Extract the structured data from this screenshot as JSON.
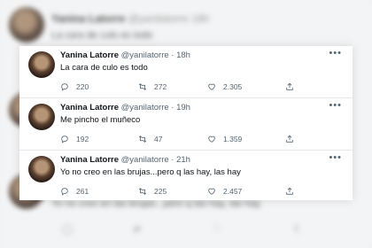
{
  "background": {
    "name": "Yanina Latorre",
    "handle": "@yanilatorre",
    "time": "18h",
    "text": "La cara de culo es todo",
    "bottom_text": "Yo no creo en las brujas...pero q las hay, las hay"
  },
  "tweets": [
    {
      "name": "Yanina Latorre",
      "handle": "@yanilatorre",
      "dot": "·",
      "time": "18h",
      "text": "La cara de culo es todo",
      "replies": "220",
      "retweets": "272",
      "likes": "2.305"
    },
    {
      "name": "Yanina Latorre",
      "handle": "@yanilatorre",
      "dot": "·",
      "time": "19h",
      "text": "Me pincho el muñeco",
      "replies": "192",
      "retweets": "47",
      "likes": "1.359"
    },
    {
      "name": "Yanina Latorre",
      "handle": "@yanilatorre",
      "dot": "·",
      "time": "21h",
      "text": "Yo no creo en las brujas...pero q las hay, las hay",
      "replies": "261",
      "retweets": "225",
      "likes": "2.457"
    }
  ],
  "icons": {
    "more": "more-horizontal-icon",
    "reply": "reply-icon",
    "retweet": "retweet-icon",
    "like": "heart-icon",
    "share": "share-icon"
  }
}
